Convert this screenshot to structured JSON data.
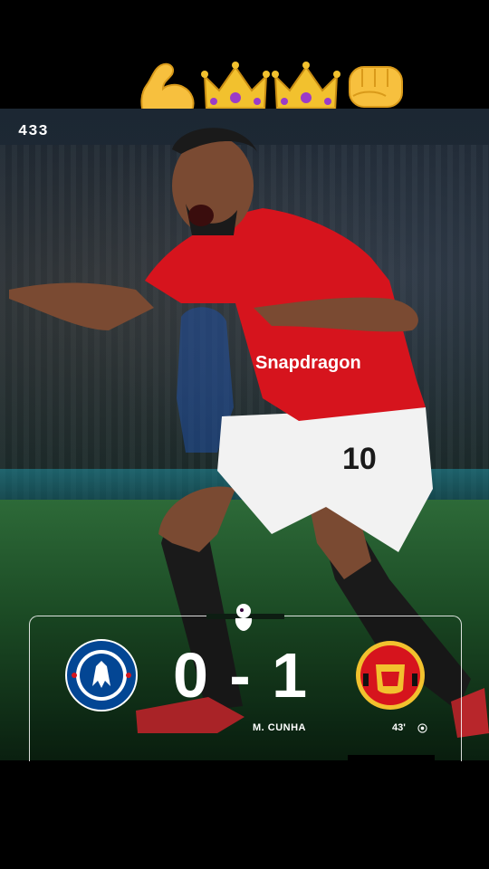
{
  "brand": {
    "logo_text": "433"
  },
  "emojis": [
    "flexed-biceps",
    "crown",
    "crown",
    "raised-fist"
  ],
  "match": {
    "home_team": "CHELSEA FOOTBALL CLUB",
    "away_team": "MANCHESTER UNITED",
    "score": "0 - 1",
    "scorer": "M. CUNHA",
    "minute": "43'"
  },
  "kit": {
    "shirt_number": "10",
    "sponsor": "Snapdragon"
  },
  "colors": {
    "man_utd_red": "#d6141d",
    "chelsea_blue": "#034694",
    "gold": "#f2c12e"
  }
}
